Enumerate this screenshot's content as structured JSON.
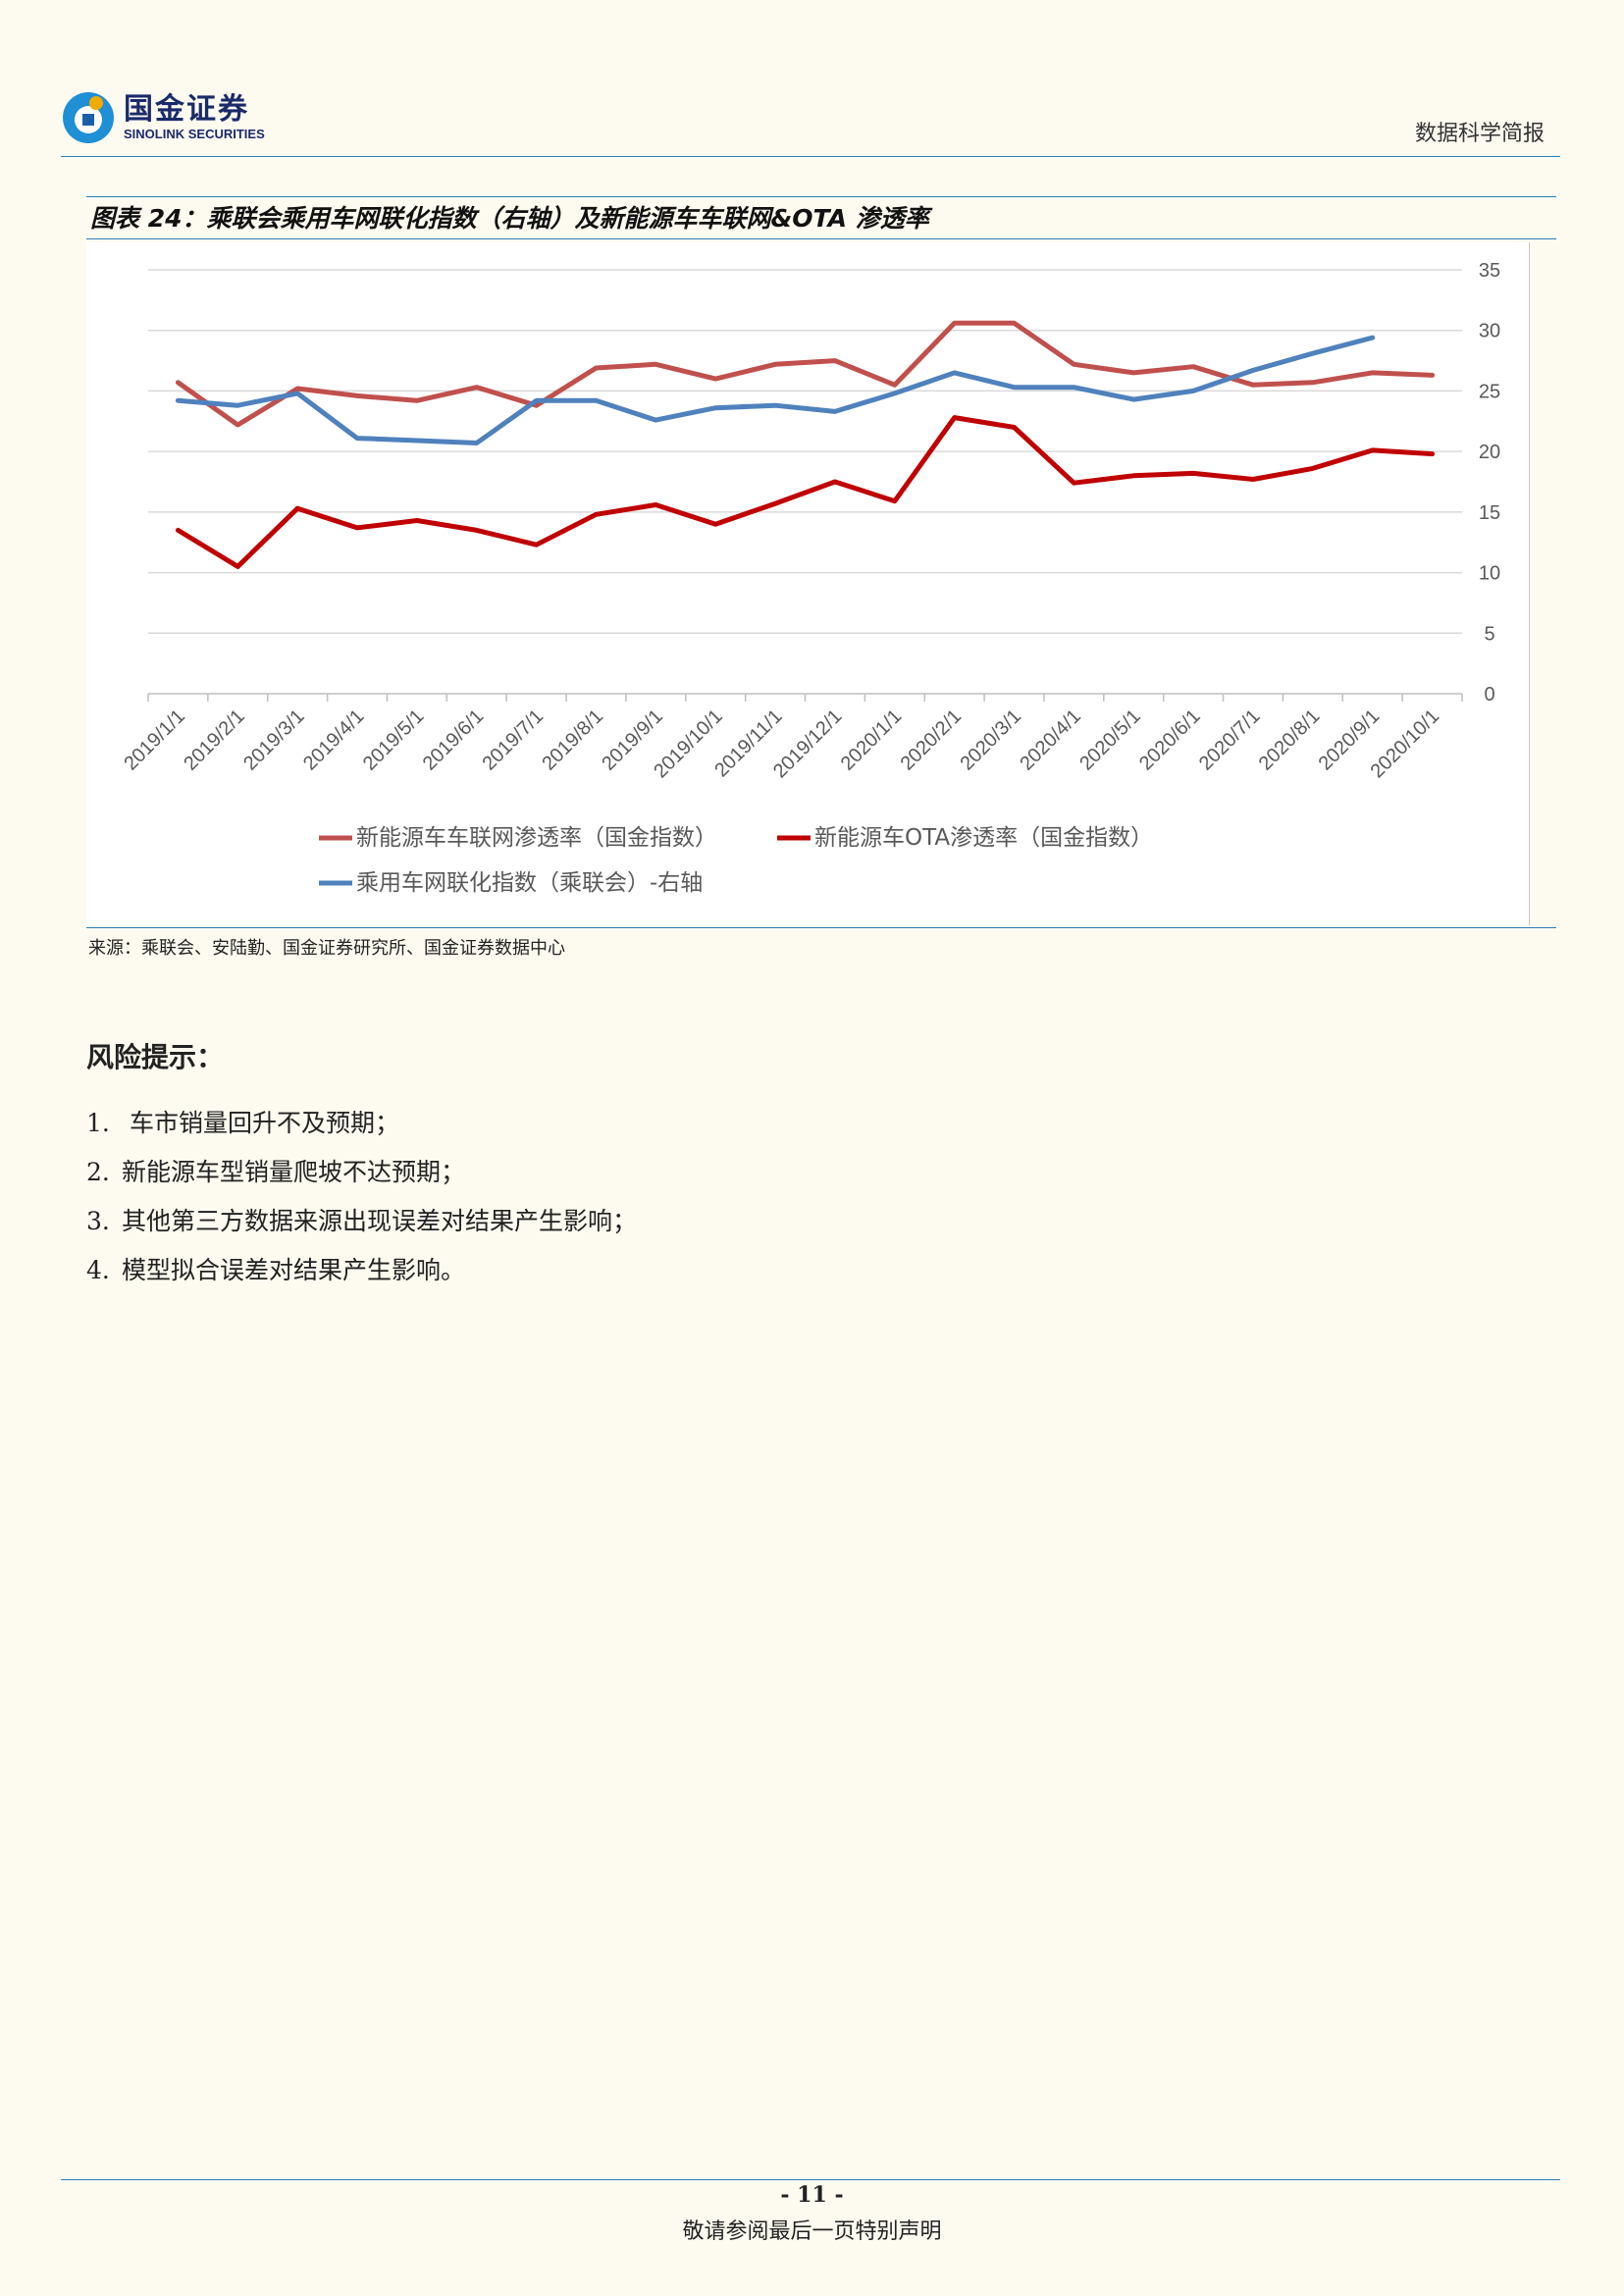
{
  "header": {
    "logo_cn": "国金证券",
    "logo_en": "SINOLINK SECURITIES",
    "report_name": "数据科学简报"
  },
  "figure": {
    "title": "图表 24：乘联会乘用车网联化指数（右轴）及新能源车车联网&OTA 渗透率",
    "source": "来源：乘联会、安陆勤、国金证券研究所、国金证券数据中心"
  },
  "chart_data": {
    "type": "line",
    "categories": [
      "2019/1/1",
      "2019/2/1",
      "2019/3/1",
      "2019/4/1",
      "2019/5/1",
      "2019/6/1",
      "2019/7/1",
      "2019/8/1",
      "2019/9/1",
      "2019/10/1",
      "2019/11/1",
      "2019/12/1",
      "2020/1/1",
      "2020/2/1",
      "2020/3/1",
      "2020/4/1",
      "2020/5/1",
      "2020/6/1",
      "2020/7/1",
      "2020/8/1",
      "2020/9/1",
      "2020/10/1"
    ],
    "ylim": [
      0,
      35
    ],
    "yticks": [
      "0",
      "5",
      "10",
      "15",
      "20",
      "25",
      "30",
      "35"
    ],
    "grid": true,
    "legend_position": "bottom",
    "series": [
      {
        "name": "新能源车车联网渗透率（国金指数）",
        "color": "#c0504d",
        "values": [
          25.7,
          22.2,
          25.2,
          24.6,
          24.2,
          25.3,
          23.8,
          26.9,
          27.2,
          26.0,
          27.2,
          27.5,
          25.5,
          30.6,
          30.6,
          27.2,
          26.5,
          27.0,
          25.5,
          25.7,
          26.5,
          26.3
        ]
      },
      {
        "name": "新能源车OTA渗透率（国金指数）",
        "color": "#c00000",
        "values": [
          13.5,
          10.5,
          15.3,
          13.7,
          14.3,
          13.5,
          12.3,
          14.8,
          15.6,
          14.0,
          15.7,
          17.5,
          15.9,
          22.8,
          22.0,
          17.4,
          18.0,
          18.2,
          17.7,
          18.6,
          20.1,
          19.8
        ]
      },
      {
        "name": "乘用车网联化指数（乘联会）-右轴",
        "color": "#4f81bd",
        "values": [
          24.2,
          23.8,
          24.8,
          21.1,
          20.9,
          20.7,
          24.2,
          24.2,
          22.6,
          23.6,
          23.8,
          23.3,
          24.8,
          26.5,
          25.3,
          25.3,
          24.3,
          25.0,
          26.7,
          28.1,
          29.4,
          null
        ]
      }
    ]
  },
  "risks": {
    "title": "风险提示：",
    "items": [
      {
        "num": "1.",
        "text": " 车市销量回升不及预期；"
      },
      {
        "num": "2.",
        "text": "新能源车型销量爬坡不达预期；"
      },
      {
        "num": "3.",
        "text": "其他第三方数据来源出现误差对结果产生影响；"
      },
      {
        "num": "4.",
        "text": "模型拟合误差对结果产生影响。"
      }
    ]
  },
  "footer": {
    "page": "- 11 -",
    "disclaimer": "敬请参阅最后一页特别声明"
  }
}
